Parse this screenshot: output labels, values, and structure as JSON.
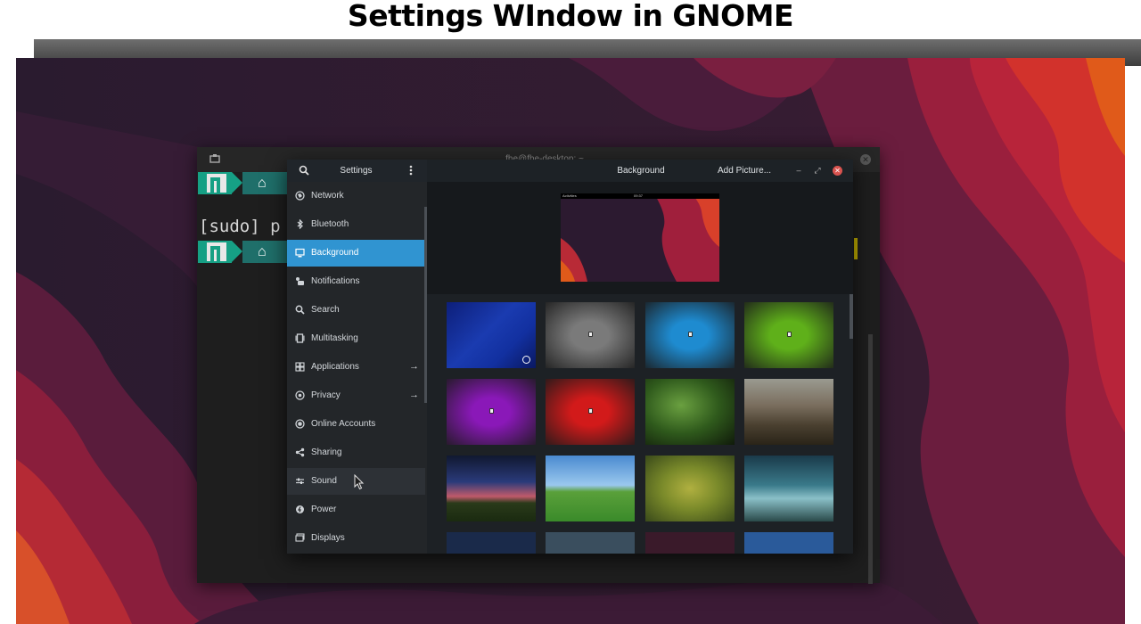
{
  "caption": "Settings WIndow in GNOME",
  "terminal": {
    "title": "fhe@fhe-desktop: ~",
    "prompt_dir": "~",
    "line_text": "[sudo] p"
  },
  "settings": {
    "sidebar_title": "Settings",
    "panel_title": "Background",
    "add_picture_label": "Add Picture...",
    "sidebar_items": [
      {
        "label": "Network",
        "icon": "network-icon"
      },
      {
        "label": "Bluetooth",
        "icon": "bluetooth-icon"
      },
      {
        "label": "Background",
        "icon": "display-icon",
        "selected": true
      },
      {
        "label": "Notifications",
        "icon": "notifications-icon"
      },
      {
        "label": "Search",
        "icon": "search-icon"
      },
      {
        "label": "Multitasking",
        "icon": "multitasking-icon"
      },
      {
        "label": "Applications",
        "icon": "apps-grid-icon",
        "has_submenu": true
      },
      {
        "label": "Privacy",
        "icon": "privacy-icon",
        "has_submenu": true
      },
      {
        "label": "Online Accounts",
        "icon": "online-accounts-icon"
      },
      {
        "label": "Sharing",
        "icon": "share-icon"
      },
      {
        "label": "Sound",
        "icon": "sound-icon",
        "hovered": true
      },
      {
        "label": "Power",
        "icon": "power-icon"
      },
      {
        "label": "Displays",
        "icon": "displays-icon"
      }
    ],
    "preview_topbar": {
      "left": "Activities",
      "center": "09:37"
    },
    "wallpapers": [
      {
        "name": "blue-texture",
        "color": "#1a3bb0",
        "selected": true
      },
      {
        "name": "gray-radial",
        "color": "#7a7a7a"
      },
      {
        "name": "cyan-radial",
        "color": "#1e8bd0"
      },
      {
        "name": "green-radial",
        "color": "#5fb01a"
      },
      {
        "name": "purple-radial",
        "color": "#8a18b8"
      },
      {
        "name": "red-radial",
        "color": "#d21a1a"
      },
      {
        "name": "leaves-photo",
        "color": "#2f5a1c"
      },
      {
        "name": "mountains-photo",
        "color": "#6a5a4a"
      },
      {
        "name": "sunset-field-photo",
        "color": "#2a3060"
      },
      {
        "name": "green-hills-photo",
        "color": "#4e9a3a"
      },
      {
        "name": "grass-closeup-photo",
        "color": "#7a8a2a"
      },
      {
        "name": "storm-photo",
        "color": "#2a6a7a"
      },
      {
        "name": "partial-1",
        "color": "#1a2a4a"
      },
      {
        "name": "partial-2",
        "color": "#3a4e5e"
      },
      {
        "name": "partial-3",
        "color": "#3a1a2a"
      },
      {
        "name": "partial-4",
        "color": "#2a5a9a"
      }
    ]
  },
  "colors": {
    "accent": "#3094d1",
    "close": "#d9534f",
    "manjaro": "#16a085"
  }
}
